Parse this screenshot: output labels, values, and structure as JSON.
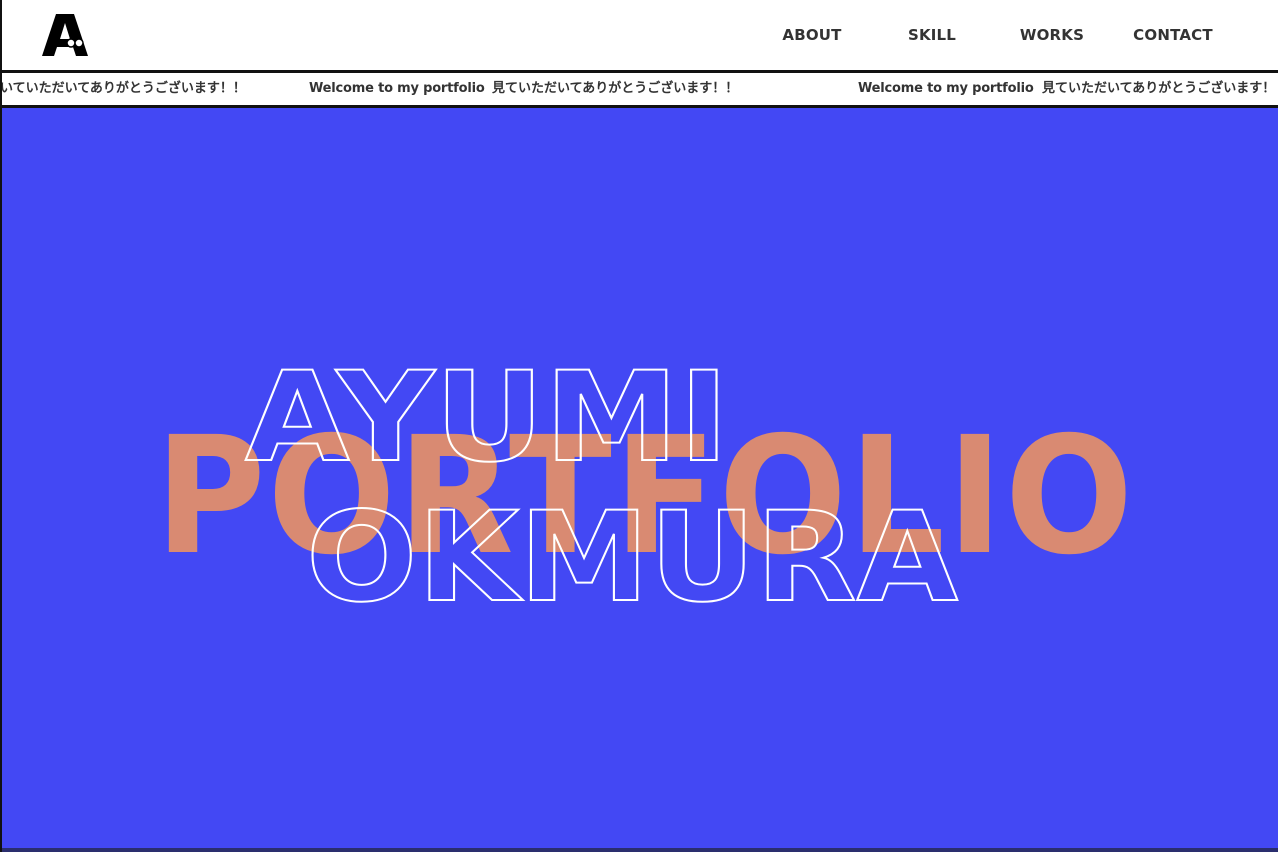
{
  "header": {
    "logo_icon": "a-with-glasses-logo-icon",
    "nav": [
      {
        "label": "ABOUT"
      },
      {
        "label": "SKILL"
      },
      {
        "label": "WORKS"
      },
      {
        "label": "CONTACT"
      }
    ]
  },
  "ticker": {
    "messages": [
      "いていただいてありがとうございます！！",
      "Welcome to my portfolio",
      "見ていただいてありがとうございます！！",
      "Welcome to my portfolio",
      "見ていただいてありがとうございます！"
    ]
  },
  "hero": {
    "background": "#4348f4",
    "accent": "#d98a72",
    "big_word": "PORTFOLIO",
    "first_name": "AYUMI",
    "last_name": "OKMURA"
  }
}
